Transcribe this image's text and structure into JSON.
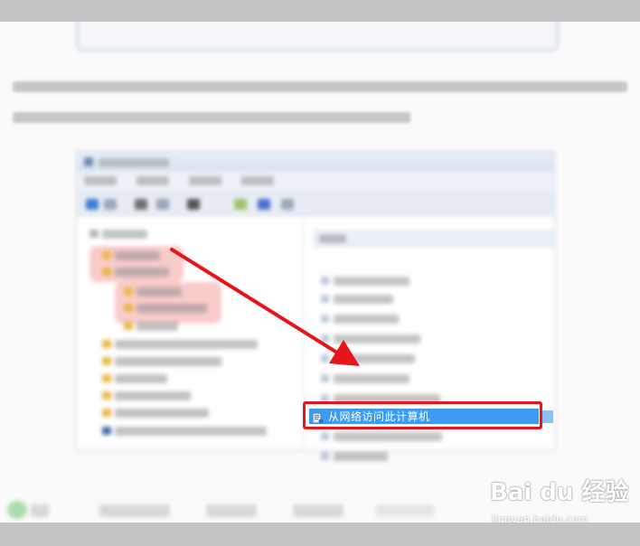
{
  "screenshot": {
    "selected_item_label": "从网络访问此计算机"
  },
  "watermark": {
    "logo_text": "Bai du 经验",
    "url": "jingyan.baidu.com"
  },
  "colors": {
    "highlight_border": "#e8141b",
    "selection_bg": "#3c9bf2",
    "arrow": "#e8141b",
    "page_bg": "#fafafa",
    "frame_bg": "#c4c4c4"
  },
  "icons": [
    "policy-icon",
    "folder-icon",
    "arrow-annotation"
  ]
}
